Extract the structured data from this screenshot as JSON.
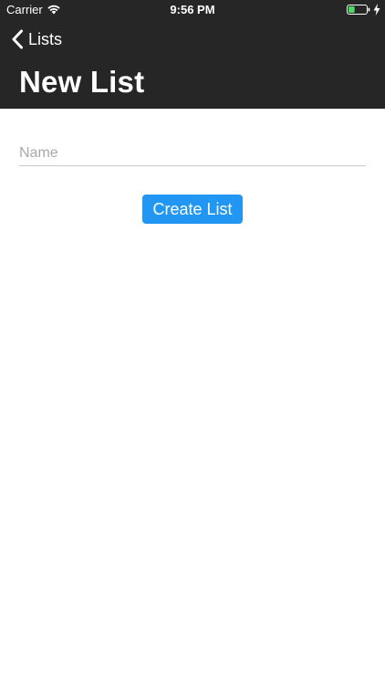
{
  "status_bar": {
    "carrier": "Carrier",
    "time": "9:56 PM",
    "battery_level": 0.35,
    "battery_color": "#4cd964",
    "charging": true
  },
  "nav": {
    "back_label": "Lists",
    "title": "New List"
  },
  "form": {
    "name_placeholder": "Name",
    "name_value": "",
    "create_label": "Create List"
  },
  "colors": {
    "header_background": "#262626",
    "button_background": "#2196f3",
    "page_background": "#ffffff"
  },
  "icons": [
    "wifi-icon",
    "battery-icon",
    "bolt-icon",
    "chevron-left-icon"
  ]
}
